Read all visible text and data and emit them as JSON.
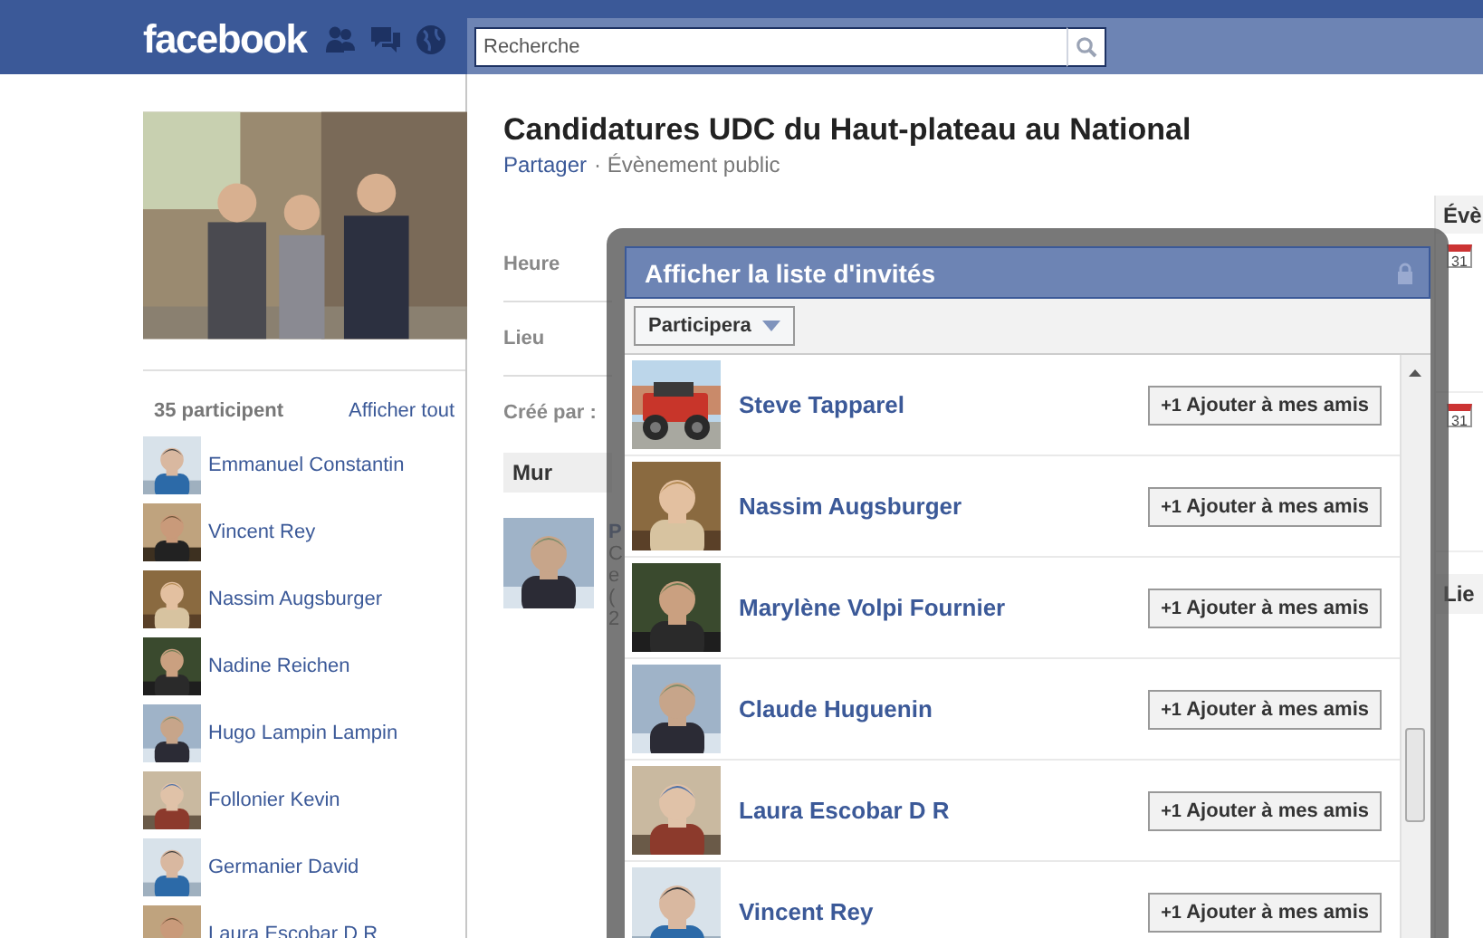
{
  "top_bar": {
    "logo": "facebook",
    "search": {
      "placeholder": "Recherche"
    }
  },
  "sidebar": {
    "count": "35 participent",
    "view_all": "Afficher tout",
    "participants": [
      {
        "name": "Emmanuel Constantin"
      },
      {
        "name": "Vincent Rey"
      },
      {
        "name": "Nassim Augsburger"
      },
      {
        "name": "Nadine Reichen"
      },
      {
        "name": "Hugo Lampin Lampin"
      },
      {
        "name": "Follonier Kevin"
      },
      {
        "name": "Germanier David"
      },
      {
        "name": "Laura Escobar D R"
      }
    ]
  },
  "event": {
    "title": "Candidatures UDC du Haut-plateau au National",
    "share": "Partager",
    "visibility": "· Évènement public",
    "fields": [
      {
        "label": "Heure"
      },
      {
        "label": "Lieu"
      },
      {
        "label": "Créé par :"
      }
    ],
    "tab": "Mur",
    "post": {
      "author": "P",
      "lines": [
        "C",
        "e",
        "(",
        "2"
      ]
    }
  },
  "right_column": {
    "heading": "Évè",
    "calendar_icons": [
      "31",
      "31"
    ],
    "heading_2": "Lie"
  },
  "dialog": {
    "title": "Afficher la liste d'invités",
    "filter": "Participera",
    "guests": [
      {
        "name": "Steve Tapparel",
        "button_icon": "+1",
        "button": "Ajouter à mes amis"
      },
      {
        "name": "Nassim Augsburger",
        "button_icon": "+1",
        "button": "Ajouter à mes amis"
      },
      {
        "name": "Marylène Volpi Fournier",
        "button_icon": "+1",
        "button": "Ajouter à mes amis"
      },
      {
        "name": "Claude Huguenin",
        "button_icon": "+1",
        "button": "Ajouter à mes amis"
      },
      {
        "name": "Laura Escobar D R",
        "button_icon": "+1",
        "button": "Ajouter à mes amis"
      },
      {
        "name": "Vincent Rey",
        "button_icon": "+1",
        "button": "Ajouter à mes amis"
      }
    ]
  }
}
